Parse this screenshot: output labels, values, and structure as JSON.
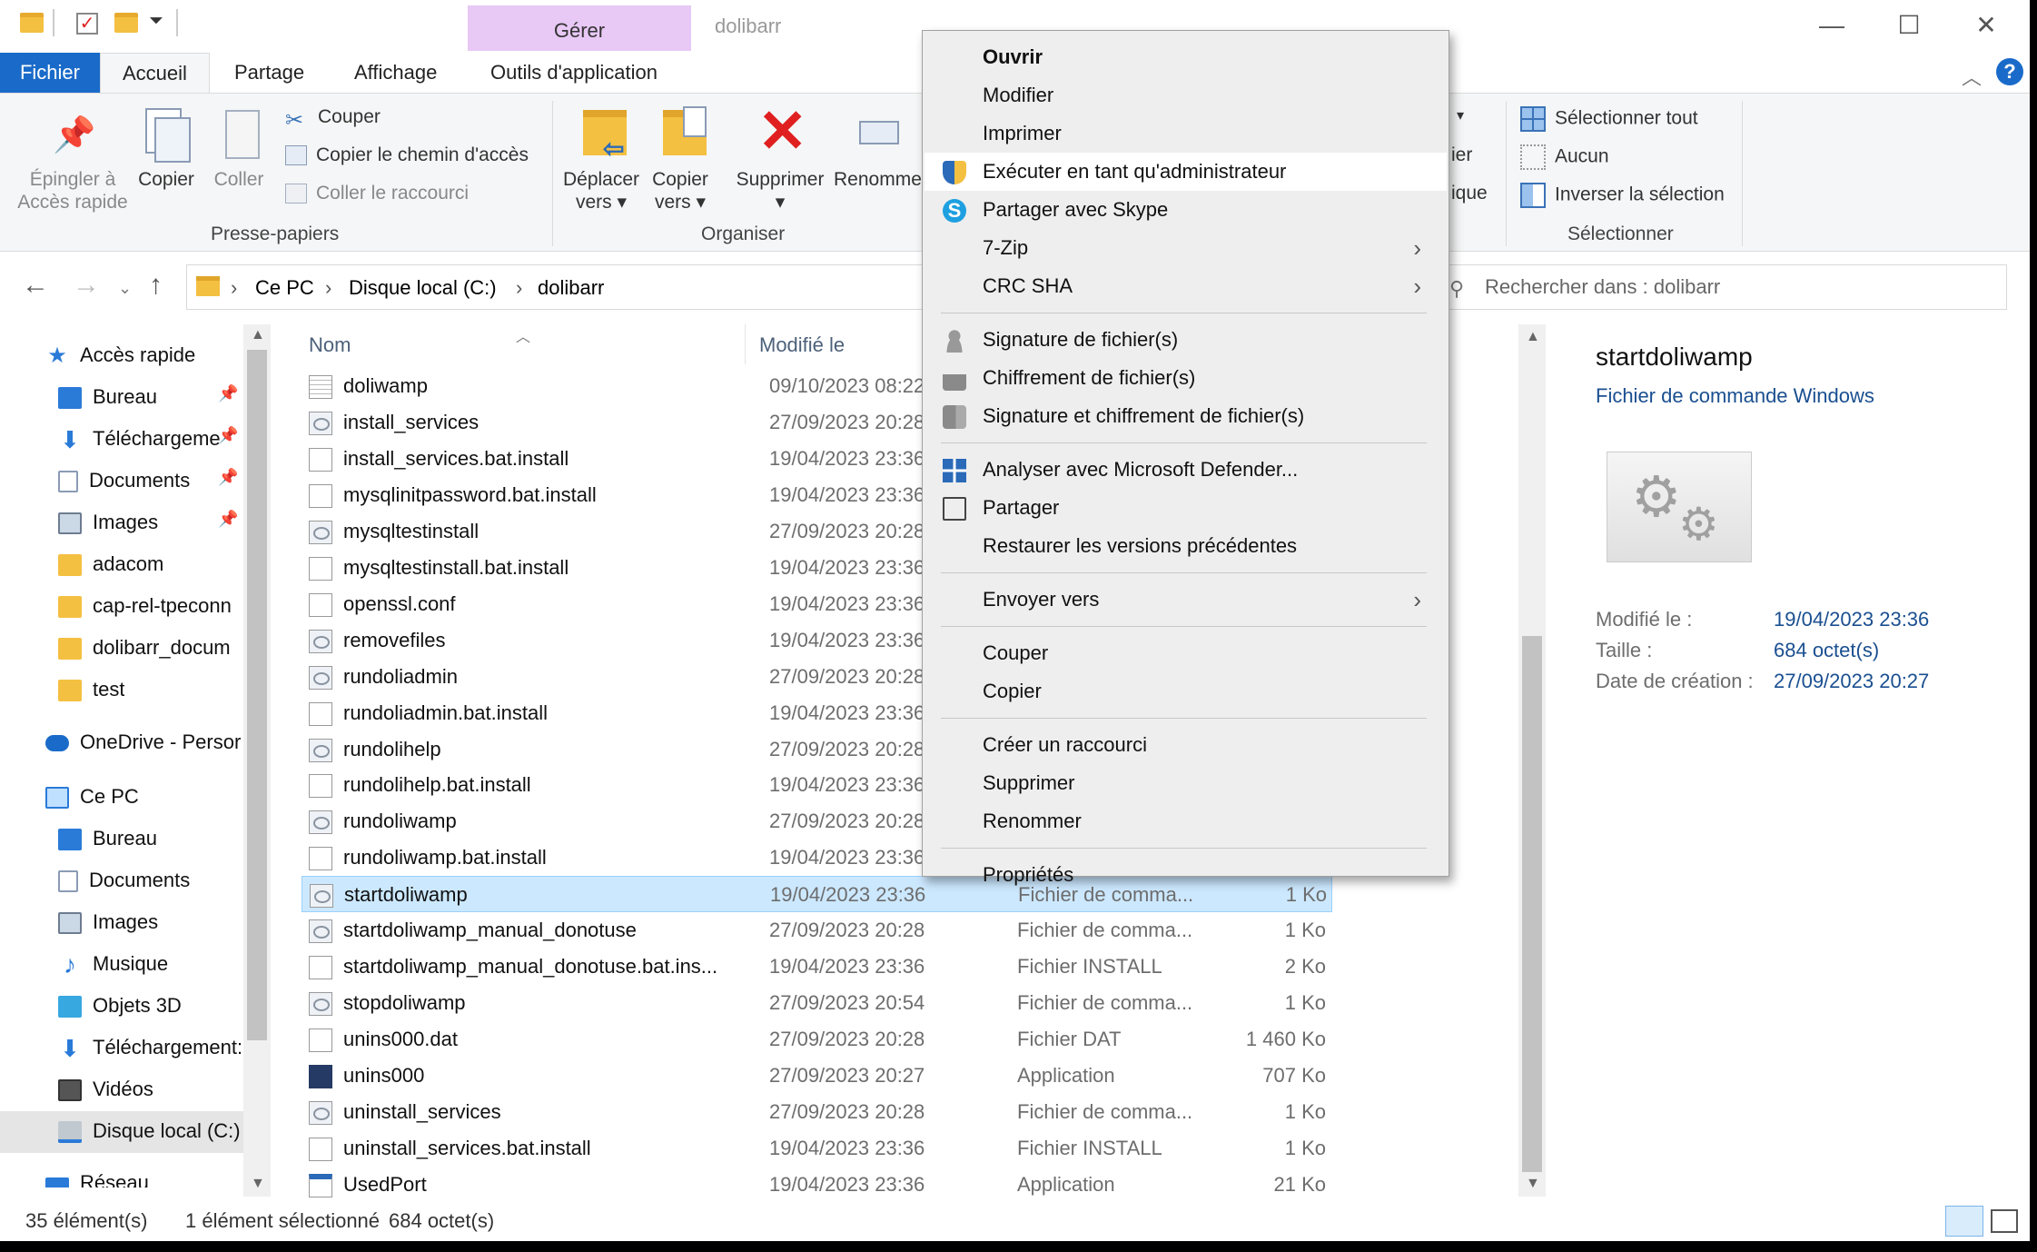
{
  "window": {
    "title": "dolibarr",
    "context_tab": "Gérer",
    "tabs": [
      "Fichier",
      "Accueil",
      "Partage",
      "Affichage",
      "Outils d'application"
    ]
  },
  "ribbon": {
    "pin_label_1": "Épingler à",
    "pin_label_2": "Accès rapide",
    "copy_label": "Copier",
    "paste_label": "Coller",
    "cut_label": "Couper",
    "copy_path_label": "Copier le chemin d'accès",
    "paste_shortcut_label": "Coller le raccourci",
    "clipboard_group": "Presse-papiers",
    "move_to_1": "Déplacer",
    "move_to_2": "vers ▾",
    "copy_to_1": "Copier",
    "copy_to_2": "vers ▾",
    "delete_label": "Supprimer",
    "delete_arrow": "▾",
    "rename_label": "Renomme",
    "organize_group": "Organiser",
    "hidden_partial_1": "ier",
    "hidden_partial_2": "ique",
    "select_all_label": "Sélectionner tout",
    "select_none_label": "Aucun",
    "invert_selection_label": "Inverser la sélection",
    "select_group": "Sélectionner"
  },
  "address": {
    "path": [
      "Ce PC",
      "Disque local (C:)",
      "dolibarr"
    ],
    "search_placeholder": "Rechercher dans : dolibarr"
  },
  "nav": {
    "quick_access": "Accès rapide",
    "items": [
      {
        "label": "Bureau",
        "pinned": true
      },
      {
        "label": "Téléchargeme",
        "pinned": true
      },
      {
        "label": "Documents",
        "pinned": true
      },
      {
        "label": "Images",
        "pinned": true
      },
      {
        "label": "adacom"
      },
      {
        "label": "cap-rel-tpeconn"
      },
      {
        "label": "dolibarr_docum"
      },
      {
        "label": "test"
      }
    ],
    "onedrive": "OneDrive - Persor",
    "this_pc": "Ce PC",
    "pc_items": [
      "Bureau",
      "Documents",
      "Images",
      "Musique",
      "Objets 3D",
      "Téléchargement:",
      "Vidéos",
      "Disque local (C:)",
      "Réseau"
    ]
  },
  "list": {
    "col_name": "Nom",
    "col_modified": "Modifié le",
    "files": [
      {
        "name": "doliwamp",
        "date": "09/10/2023 08:22",
        "type": "",
        "size": "",
        "icon": "doc"
      },
      {
        "name": "install_services",
        "date": "27/09/2023 20:28",
        "type": "",
        "size": "",
        "icon": "bat"
      },
      {
        "name": "install_services.bat.install",
        "date": "19/04/2023 23:36",
        "type": "",
        "size": "",
        "icon": "file"
      },
      {
        "name": "mysqlinitpassword.bat.install",
        "date": "19/04/2023 23:36",
        "type": "",
        "size": "",
        "icon": "file"
      },
      {
        "name": "mysqltestinstall",
        "date": "27/09/2023 20:28",
        "type": "",
        "size": "",
        "icon": "bat"
      },
      {
        "name": "mysqltestinstall.bat.install",
        "date": "19/04/2023 23:36",
        "type": "",
        "size": "",
        "icon": "file"
      },
      {
        "name": "openssl.conf",
        "date": "19/04/2023 23:36",
        "type": "",
        "size": "",
        "icon": "file"
      },
      {
        "name": "removefiles",
        "date": "19/04/2023 23:36",
        "type": "",
        "size": "",
        "icon": "bat"
      },
      {
        "name": "rundoliadmin",
        "date": "27/09/2023 20:28",
        "type": "",
        "size": "",
        "icon": "bat"
      },
      {
        "name": "rundoliadmin.bat.install",
        "date": "19/04/2023 23:36",
        "type": "",
        "size": "",
        "icon": "file"
      },
      {
        "name": "rundolihelp",
        "date": "27/09/2023 20:28",
        "type": "",
        "size": "",
        "icon": "bat"
      },
      {
        "name": "rundolihelp.bat.install",
        "date": "19/04/2023 23:36",
        "type": "",
        "size": "",
        "icon": "file"
      },
      {
        "name": "rundoliwamp",
        "date": "27/09/2023 20:28",
        "type": "",
        "size": "",
        "icon": "bat"
      },
      {
        "name": "rundoliwamp.bat.install",
        "date": "19/04/2023 23:36",
        "type": "",
        "size": "",
        "icon": "file"
      },
      {
        "name": "startdoliwamp",
        "date": "19/04/2023 23:36",
        "type": "Fichier de comma...",
        "size": "1 Ko",
        "icon": "bat",
        "selected": true
      },
      {
        "name": "startdoliwamp_manual_donotuse",
        "date": "27/09/2023 20:28",
        "type": "Fichier de comma...",
        "size": "1 Ko",
        "icon": "bat"
      },
      {
        "name": "startdoliwamp_manual_donotuse.bat.ins...",
        "date": "19/04/2023 23:36",
        "type": "Fichier INSTALL",
        "size": "2 Ko",
        "icon": "file"
      },
      {
        "name": "stopdoliwamp",
        "date": "27/09/2023 20:54",
        "type": "Fichier de comma...",
        "size": "1 Ko",
        "icon": "bat"
      },
      {
        "name": "unins000.dat",
        "date": "27/09/2023 20:28",
        "type": "Fichier DAT",
        "size": "1 460 Ko",
        "icon": "file"
      },
      {
        "name": "unins000",
        "date": "27/09/2023 20:27",
        "type": "Application",
        "size": "707 Ko",
        "icon": "app"
      },
      {
        "name": "uninstall_services",
        "date": "27/09/2023 20:28",
        "type": "Fichier de comma...",
        "size": "1 Ko",
        "icon": "bat"
      },
      {
        "name": "uninstall_services.bat.install",
        "date": "19/04/2023 23:36",
        "type": "Fichier INSTALL",
        "size": "1 Ko",
        "icon": "file"
      },
      {
        "name": "UsedPort",
        "date": "19/04/2023 23:36",
        "type": "Application",
        "size": "21 Ko",
        "icon": "appwin"
      }
    ]
  },
  "preview": {
    "filename": "startdoliwamp",
    "filetype": "Fichier de commande Windows",
    "modified_label": "Modifié le :",
    "modified_value": "19/04/2023 23:36",
    "size_label": "Taille :",
    "size_value": "684 octet(s)",
    "created_label": "Date de création :",
    "created_value": "27/09/2023 20:27"
  },
  "status": {
    "count": "35 élément(s)",
    "selection": "1 élément sélectionné",
    "selection_size": "684 octet(s)"
  },
  "context_menu": {
    "items": [
      {
        "label": "Ouvrir",
        "bold": true
      },
      {
        "label": "Modifier"
      },
      {
        "label": "Imprimer"
      },
      {
        "label": "Exécuter en tant qu'administrateur",
        "icon": "shield-icon",
        "highlight": true
      },
      {
        "label": "Partager avec Skype",
        "icon": "skype-icon"
      },
      {
        "label": "7-Zip",
        "submenu": true
      },
      {
        "label": "CRC SHA",
        "submenu": true
      },
      {
        "sep": true
      },
      {
        "label": "Signature de fichier(s)",
        "icon": "user-icon"
      },
      {
        "label": "Chiffrement de fichier(s)",
        "icon": "lock-icon"
      },
      {
        "label": "Signature et chiffrement de fichier(s)",
        "icon": "lock-user-icon"
      },
      {
        "sep": true
      },
      {
        "label": "Analyser avec Microsoft Defender...",
        "icon": "defender-icon"
      },
      {
        "label": "Partager",
        "icon": "share-icon"
      },
      {
        "label": "Restaurer les versions précédentes"
      },
      {
        "sep": true
      },
      {
        "label": "Envoyer vers",
        "submenu": true
      },
      {
        "sep": true
      },
      {
        "label": "Couper"
      },
      {
        "label": "Copier"
      },
      {
        "sep": true
      },
      {
        "label": "Créer un raccourci"
      },
      {
        "label": "Supprimer"
      },
      {
        "label": "Renommer"
      },
      {
        "sep": true
      },
      {
        "label": "Propriétés"
      }
    ]
  },
  "colors": {
    "accent": "#1a6bc9",
    "selection": "#cce8ff",
    "context_tab": "#e8c8f5"
  }
}
